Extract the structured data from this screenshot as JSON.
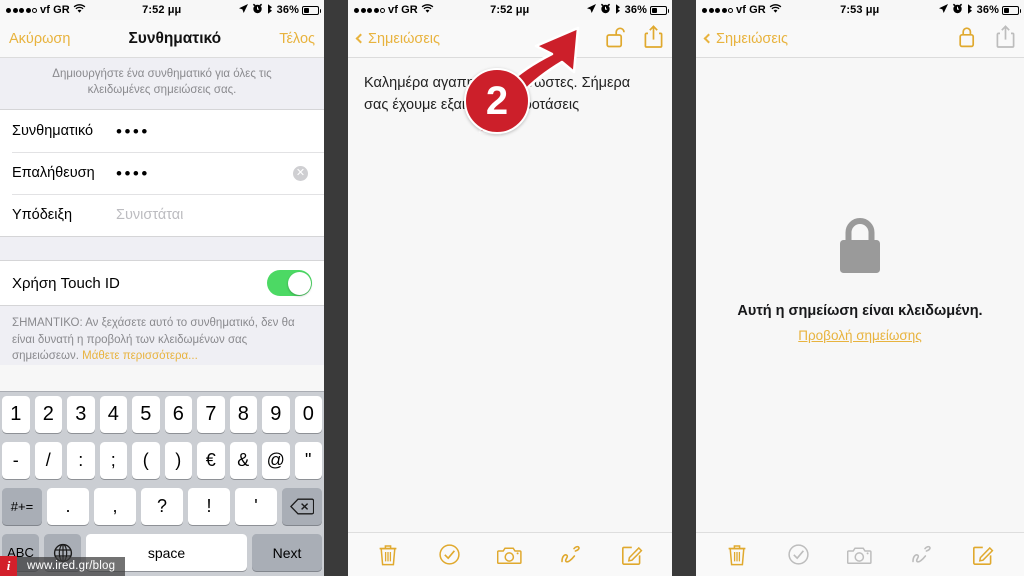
{
  "theme": {
    "gold": "#e0a92e",
    "gold_text": "#e8b33e",
    "green_toggle": "#4cd964",
    "annotation_red": "#cc1f2a",
    "panel_bg": "#f7f7f7",
    "group_bg": "#efeff4",
    "keyboard_bg": "#cbced3",
    "dim_grey": "#bdbdbd"
  },
  "watermark": {
    "badge": "i",
    "text": "www.ired.gr/blog"
  },
  "panels": [
    {
      "id": "passcode-setup",
      "statusbar": {
        "carrier": "vf GR",
        "signal_dots_filled": 4,
        "signal_dots_total": 5,
        "wifi_icon": "wifi-icon",
        "time": "7:52 μμ",
        "location_icon": "location-arrow-icon",
        "alarm_icon": "alarm-clock-icon",
        "bluetooth_icon": "bluetooth-icon",
        "battery_percent": "36%",
        "battery_level": 36
      },
      "navbar": {
        "left_label": "Ακύρωση",
        "title": "Συνθηματικό",
        "right_label": "Τέλος"
      },
      "form": {
        "header_note": "Δημιουργήστε ένα συνθηματικό για όλες τις κλειδωμένες σημειώσεις σας.",
        "rows": [
          {
            "label": "Συνθηματικό",
            "value": "••••",
            "placeholder": "",
            "masked": true,
            "clear_button": false
          },
          {
            "label": "Επαλήθευση",
            "value": "••••",
            "placeholder": "",
            "masked": true,
            "clear_button": true
          },
          {
            "label": "Υπόδειξη",
            "value": "",
            "placeholder": "Συνιστάται",
            "masked": false,
            "clear_button": false
          }
        ],
        "toggle": {
          "label": "Χρήση Touch ID",
          "state": "on"
        },
        "warning_prefix": "ΣΗΜΑΝΤΙΚΟ: Αν ξεχάσετε αυτό το συνθηματικό, δεν θα είναι δυνατή η προβολή των κλειδωμένων σας σημειώσεων. ",
        "warning_link": "Μάθετε περισσότερα..."
      },
      "keyboard": {
        "row1": [
          "1",
          "2",
          "3",
          "4",
          "5",
          "6",
          "7",
          "8",
          "9",
          "0"
        ],
        "row2": [
          "-",
          "/",
          ":",
          ";",
          "(",
          ")",
          "€",
          "&",
          "@",
          "\""
        ],
        "row3": {
          "shift": "#+=",
          "keys": [
            ".",
            ",",
            "?",
            "!",
            "'"
          ],
          "backspace_icon": "backspace-icon"
        },
        "row4": {
          "abc": "ABC",
          "globe_icon": "globe-icon",
          "space": "space",
          "action": "Next"
        }
      }
    },
    {
      "id": "note-unlocked",
      "statusbar": {
        "carrier": "vf GR",
        "signal_dots_filled": 4,
        "signal_dots_total": 5,
        "time": "7:52 μμ",
        "battery_percent": "36%",
        "battery_level": 36
      },
      "navbar": {
        "back_label": "Σημειώσεις",
        "icons": [
          {
            "name": "unlock-icon",
            "state": "gold"
          },
          {
            "name": "share-icon",
            "state": "gold"
          }
        ]
      },
      "note_text": "Καλημέρα αγαπητοί αναγνώστες. Σήμερα σας έχουμε εξαιρετικές προτάσεις",
      "annotation": {
        "step": "2",
        "arrow": "arrow-up-right",
        "target": "unlock-icon"
      },
      "toolbar": [
        {
          "name": "trash-icon",
          "state": "gold"
        },
        {
          "name": "checklist-icon",
          "state": "gold"
        },
        {
          "name": "camera-icon",
          "state": "gold"
        },
        {
          "name": "sketch-icon",
          "state": "gold"
        },
        {
          "name": "compose-icon",
          "state": "gold"
        }
      ]
    },
    {
      "id": "note-locked",
      "statusbar": {
        "carrier": "vf GR",
        "signal_dots_filled": 4,
        "signal_dots_total": 5,
        "time": "7:53 μμ",
        "battery_percent": "36%",
        "battery_level": 36
      },
      "navbar": {
        "back_label": "Σημειώσεις",
        "icons": [
          {
            "name": "lock-icon",
            "state": "gold"
          },
          {
            "name": "share-icon",
            "state": "dim"
          }
        ]
      },
      "locked": {
        "lock_icon": "big-lock-icon",
        "message": "Αυτή η σημείωση είναι κλειδωμένη.",
        "action_link": "Προβολή σημείωσης"
      },
      "toolbar": [
        {
          "name": "trash-icon",
          "state": "gold"
        },
        {
          "name": "checklist-icon",
          "state": "dim"
        },
        {
          "name": "camera-icon",
          "state": "dim"
        },
        {
          "name": "sketch-icon",
          "state": "dim"
        },
        {
          "name": "compose-icon",
          "state": "gold"
        }
      ]
    }
  ]
}
